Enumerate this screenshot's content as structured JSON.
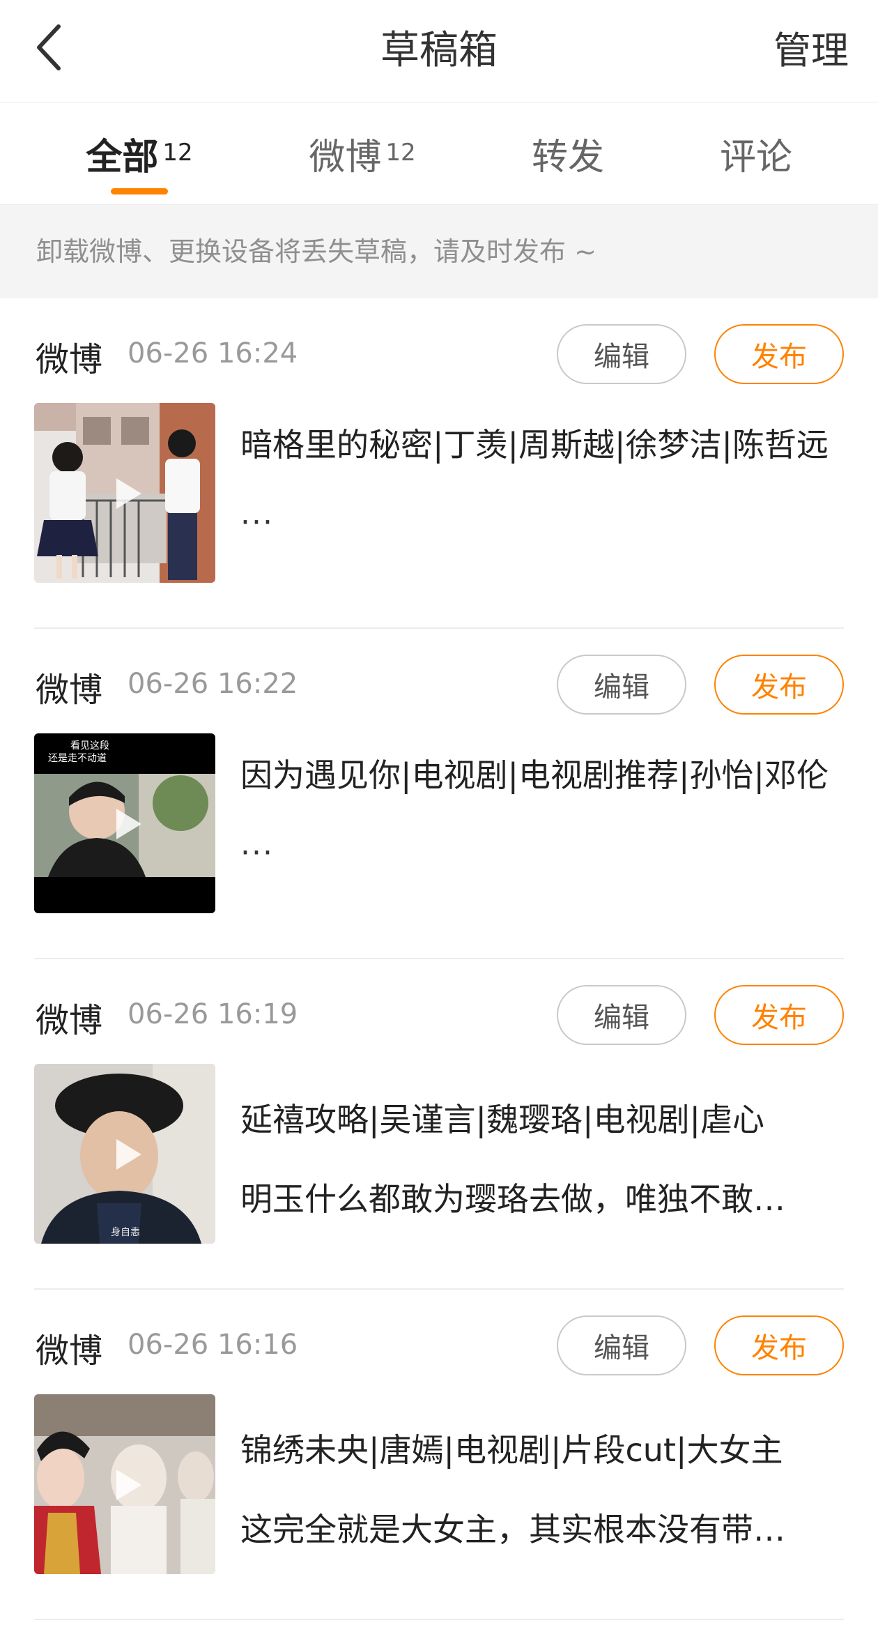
{
  "header": {
    "title": "草稿箱",
    "manage_label": "管理",
    "back_icon": "chevron-left-icon"
  },
  "tabs": [
    {
      "label": "全部",
      "count": "12",
      "active": true
    },
    {
      "label": "微博",
      "count": "12",
      "active": false
    },
    {
      "label": "转发",
      "count": "",
      "active": false
    },
    {
      "label": "评论",
      "count": "",
      "active": false
    }
  ],
  "accent_color": "#ff8200",
  "notice": "卸载微博、更换设备将丢失草稿，请及时发布 ~",
  "drafts": [
    {
      "source": "微博",
      "time": "06-26 16:24",
      "edit_label": "编辑",
      "publish_label": "发布",
      "title": "暗格里的秘密|丁羡|周斯越|徐梦洁|陈哲远",
      "body": "",
      "ellipsis": "···"
    },
    {
      "source": "微博",
      "time": "06-26 16:22",
      "edit_label": "编辑",
      "publish_label": "发布",
      "title": "因为遇见你|电视剧|电视剧推荐|孙怡|邓伦",
      "body": "",
      "ellipsis": "···",
      "thumb_caption_1": "看见这段",
      "thumb_caption_2": "还是走不动道"
    },
    {
      "source": "微博",
      "time": "06-26 16:19",
      "edit_label": "编辑",
      "publish_label": "发布",
      "title": "延禧攻略|吴谨言|魏璎珞|电视剧|虐心",
      "body": "明玉什么都敢为璎珞去做，唯独不敢…",
      "ellipsis": "",
      "thumb_caption_1": "身自恚"
    },
    {
      "source": "微博",
      "time": "06-26 16:16",
      "edit_label": "编辑",
      "publish_label": "发布",
      "title": "锦绣未央|唐嫣|电视剧|片段cut|大女主",
      "body": "这完全就是大女主，其实根本没有带…",
      "ellipsis": ""
    }
  ]
}
